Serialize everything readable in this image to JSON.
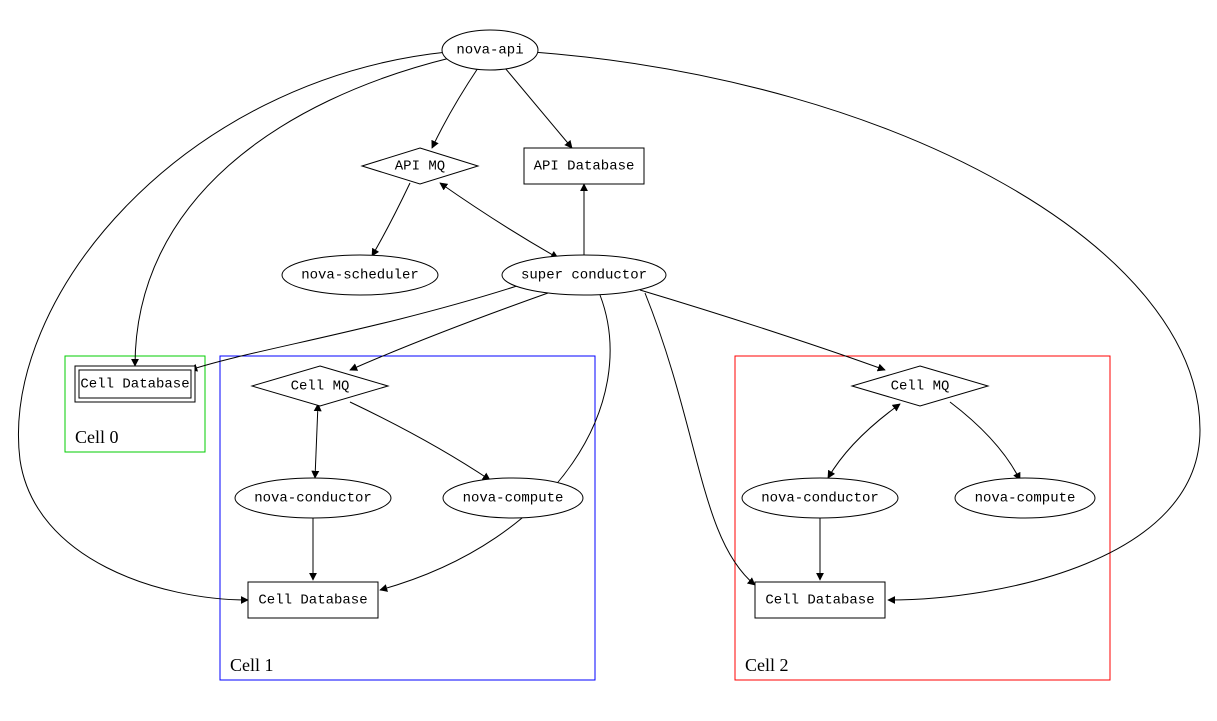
{
  "nodes": {
    "nova_api": {
      "label": "nova-api"
    },
    "api_mq": {
      "label": "API MQ"
    },
    "api_db": {
      "label": "API Database"
    },
    "nova_scheduler": {
      "label": "nova-scheduler"
    },
    "super_conductor": {
      "label": "super conductor"
    },
    "cell0_db": {
      "label": "Cell Database"
    },
    "cell1_mq": {
      "label": "Cell MQ"
    },
    "cell1_conductor": {
      "label": "nova-conductor"
    },
    "cell1_compute": {
      "label": "nova-compute"
    },
    "cell1_db": {
      "label": "Cell Database"
    },
    "cell2_mq": {
      "label": "Cell MQ"
    },
    "cell2_conductor": {
      "label": "nova-conductor"
    },
    "cell2_compute": {
      "label": "nova-compute"
    },
    "cell2_db": {
      "label": "Cell Database"
    }
  },
  "clusters": {
    "cell0": {
      "label": "Cell 0",
      "color": "#00cc00"
    },
    "cell1": {
      "label": "Cell 1",
      "color": "#0000ff"
    },
    "cell2": {
      "label": "Cell 2",
      "color": "#ff0000"
    }
  }
}
